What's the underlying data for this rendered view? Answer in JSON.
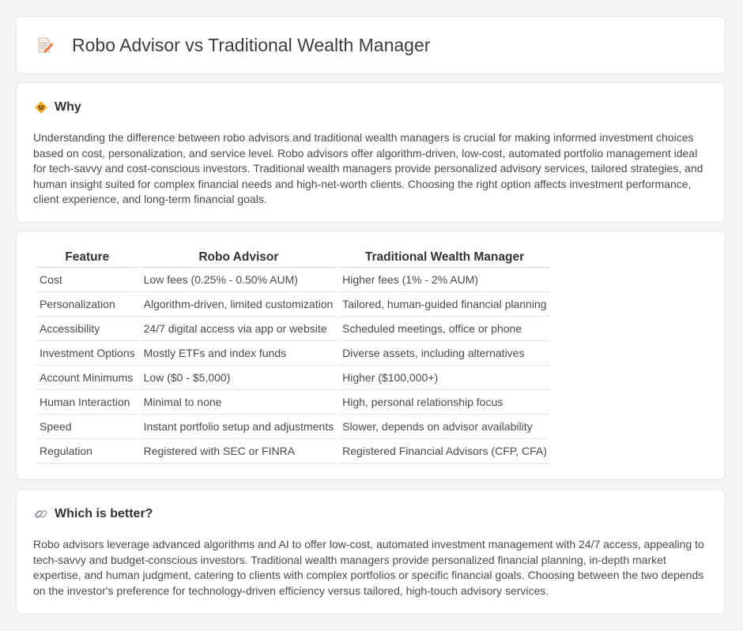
{
  "header": {
    "title": "Robo Advisor vs Traditional Wealth Manager",
    "icon": "document-pencil-icon"
  },
  "why": {
    "title": "Why",
    "icon": "diamond-sign-icon",
    "body": "Understanding the difference between robo advisors and traditional wealth managers is crucial for making informed investment choices based on cost, personalization, and service level. Robo advisors offer algorithm-driven, low-cost, automated portfolio management ideal for tech-savvy and cost-conscious investors. Traditional wealth managers provide personalized advisory services, tailored strategies, and human insight suited for complex financial needs and high-net-worth clients. Choosing the right option affects investment performance, client experience, and long-term financial goals."
  },
  "table": {
    "headers": [
      "Feature",
      "Robo Advisor",
      "Traditional Wealth Manager"
    ],
    "rows": [
      [
        "Cost",
        "Low fees (0.25% - 0.50% AUM)",
        "Higher fees (1% - 2% AUM)"
      ],
      [
        "Personalization",
        "Algorithm-driven, limited customization",
        "Tailored, human-guided financial planning"
      ],
      [
        "Accessibility",
        "24/7 digital access via app or website",
        "Scheduled meetings, office or phone"
      ],
      [
        "Investment Options",
        "Mostly ETFs and index funds",
        "Diverse assets, including alternatives"
      ],
      [
        "Account Minimums",
        "Low ($0 - $5,000)",
        "Higher ($100,000+)"
      ],
      [
        "Human Interaction",
        "Minimal to none",
        "High, personal relationship focus"
      ],
      [
        "Speed",
        "Instant portfolio setup and adjustments",
        "Slower, depends on advisor availability"
      ],
      [
        "Regulation",
        "Registered with SEC or FINRA",
        "Registered Financial Advisors (CFP, CFA)"
      ]
    ]
  },
  "better": {
    "title": "Which is better?",
    "icon": "link-icon",
    "body": "Robo advisors leverage advanced algorithms and AI to offer low-cost, automated investment management with 24/7 access, appealing to tech-savvy and budget-conscious investors. Traditional wealth managers provide personalized financial planning, in-depth market expertise, and human judgment, catering to clients with complex portfolios or specific financial goals. Choosing between the two depends on the investor's preference for technology-driven efficiency versus tailored, high-touch advisory services."
  }
}
